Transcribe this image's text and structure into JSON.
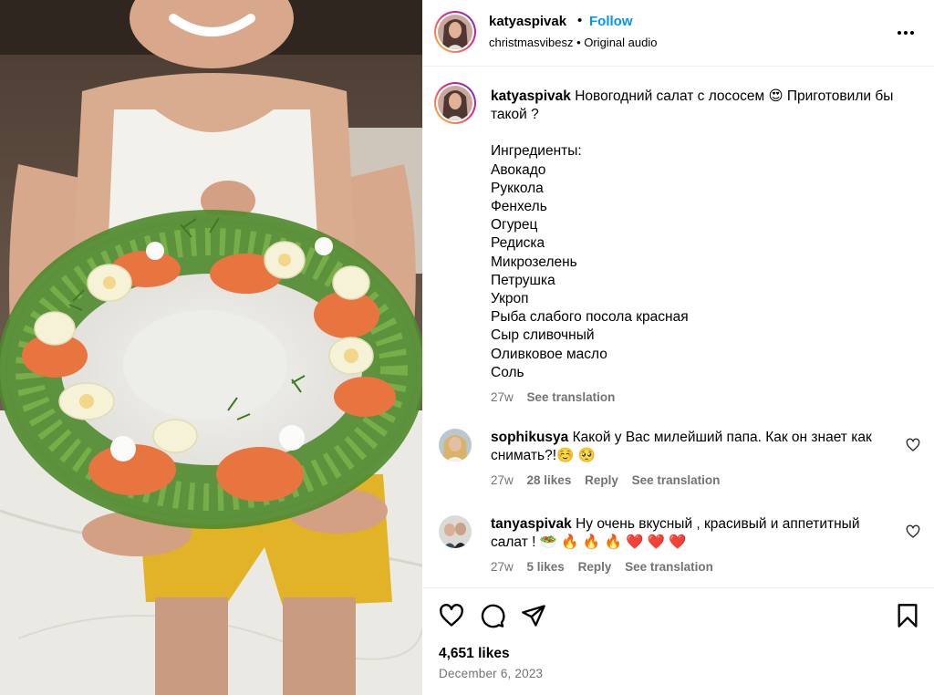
{
  "header": {
    "username": "katyaspivak",
    "dot": "•",
    "follow_label": "Follow",
    "audio_line": "christmasvibesz • Original audio",
    "more_icon": "more-horizontal-icon"
  },
  "caption": {
    "username": "katyaspivak",
    "text": "Новогодний салат с лососем 😍 Приготовили бы такой ?",
    "ingredients_heading": "Ингредиенты:",
    "ingredients": [
      "Авокадо",
      "Руккола",
      "Фенхель",
      "Огурец",
      "Редиска",
      "Микрозелень",
      "Петрушка",
      "Укроп",
      "Рыба слабого посола красная",
      "Сыр сливочный",
      "Оливковое масло",
      "Соль"
    ],
    "age": "27w",
    "see_translation": "See translation"
  },
  "comments": [
    {
      "username": "sophikusya",
      "text": "Какой у Вас милейший папа. Как он знает как снимать?!☺️ 🥺",
      "age": "27w",
      "likes": "28 likes",
      "reply": "Reply",
      "see_translation": "See translation"
    },
    {
      "username": "tanyaspivak",
      "text": "Ну очень вкусный , красивый и аппетитный салат ! 🥗 🔥 🔥 🔥 ❤️ ❤️ ❤️",
      "age": "27w",
      "likes": "5 likes",
      "reply": "Reply",
      "see_translation": "See translation"
    }
  ],
  "footer": {
    "likes": "4,651 likes",
    "date": "December 6, 2023"
  },
  "icons": [
    "heart-icon",
    "comment-icon",
    "share-icon",
    "bookmark-icon"
  ],
  "colors": {
    "accent": "#0095f6",
    "secondary_text": "#737373",
    "divider": "#efefef"
  }
}
